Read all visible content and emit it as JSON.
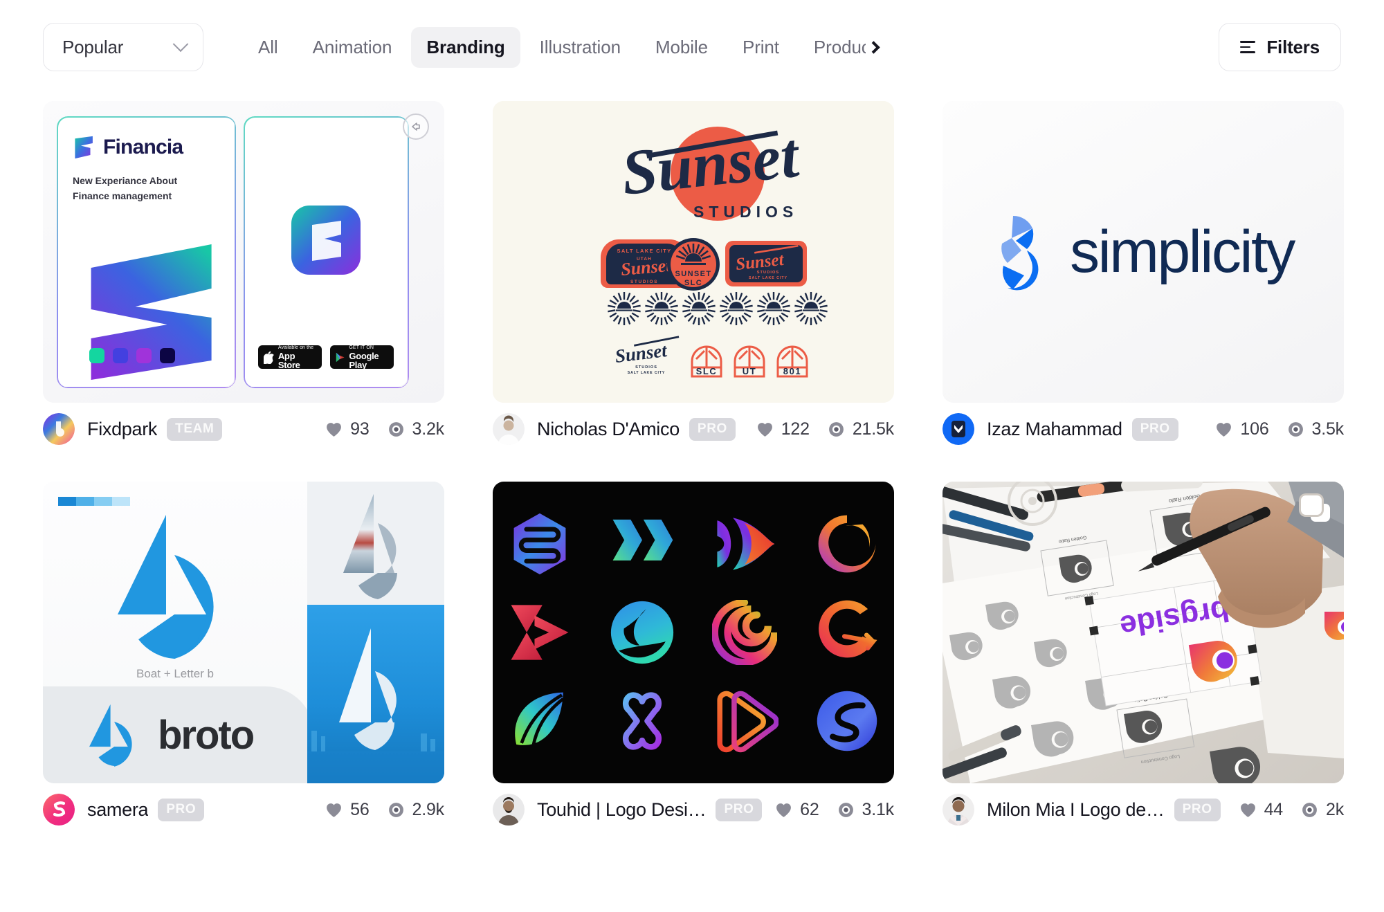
{
  "toolbar": {
    "sort": {
      "label": "Popular",
      "icon": "chevron-down-icon"
    },
    "tabs": [
      {
        "label": "All",
        "active": false
      },
      {
        "label": "Animation",
        "active": false
      },
      {
        "label": "Branding",
        "active": true
      },
      {
        "label": "Illustration",
        "active": false
      },
      {
        "label": "Mobile",
        "active": false
      },
      {
        "label": "Print",
        "active": false
      },
      {
        "label": "Product Design",
        "active": false
      }
    ],
    "next_icon": "chevron-right-icon",
    "filters": {
      "label": "Filters",
      "icon": "filter-icon"
    }
  },
  "shots": [
    {
      "id": "financia",
      "author": "Fixdpark",
      "badge": "TEAM",
      "likes": "93",
      "views": "3.2k",
      "overlay_icon": "back-arrow-icon",
      "art": {
        "brand": "Financia",
        "tagline_line1": "New Experiance About",
        "tagline_line2": "Finance management",
        "swatches": [
          "#14d6a0",
          "#4340e0",
          "#a033da",
          "#0c0544"
        ],
        "stores": [
          {
            "small": "Available on the",
            "big": "App Store"
          },
          {
            "small": "GET IT ON",
            "big": "Google Play"
          }
        ]
      }
    },
    {
      "id": "sunset-studios",
      "author": "Nicholas D'Amico",
      "badge": "PRO",
      "likes": "122",
      "views": "21.5k",
      "art": {
        "wordmark": "Sunset",
        "subtitle": "STUDIOS",
        "badge_arch_top": "SALT LAKE CITY",
        "badge_arch_sub": "UTAH",
        "badge_arch_script": "Sunset",
        "badge_arch_foot": "STUDIOS",
        "badge_circle_line1": "SUNSET",
        "badge_circle_line2": "SLC",
        "badge_rect_script": "Sunset",
        "windows": [
          "SLC",
          "UT",
          "801"
        ],
        "colors": {
          "navy": "#1d2a46",
          "coral": "#ec5c46",
          "cream": "#f9f7ee"
        }
      }
    },
    {
      "id": "simplicity",
      "author": "Izaz Mahammad",
      "badge": "PRO",
      "likes": "106",
      "views": "3.5k",
      "art": {
        "wordmark": "simplicity",
        "colors": {
          "dark": "#102a54",
          "blue": "#0b6ef2",
          "light_blue": "#7fa9f0"
        }
      }
    },
    {
      "id": "broto",
      "author": "samera",
      "badge": "PRO",
      "likes": "56",
      "views": "2.9k",
      "art": {
        "caption": "Boat + Letter b",
        "wordmark": "broto",
        "color": "#2197e0"
      }
    },
    {
      "id": "logo-collection",
      "author": "Touhid | Logo Desi…",
      "badge": "PRO",
      "likes": "62",
      "views": "3.1k",
      "art": {
        "background": "#050505",
        "count": 12,
        "rows": 3,
        "cols": 4
      }
    },
    {
      "id": "dragside-process",
      "author": "Milon Mia I Logo de…",
      "badge": "PRO",
      "likes": "44",
      "views": "2k",
      "multi_icon": "multiple-shots-icon",
      "art": {
        "printed_wordmark": "brgside",
        "annotation": "Golden Ratio",
        "annotation_2": "Logo Construction"
      }
    }
  ],
  "icons": {
    "heart": "heart-icon",
    "eye": "eye-icon"
  }
}
